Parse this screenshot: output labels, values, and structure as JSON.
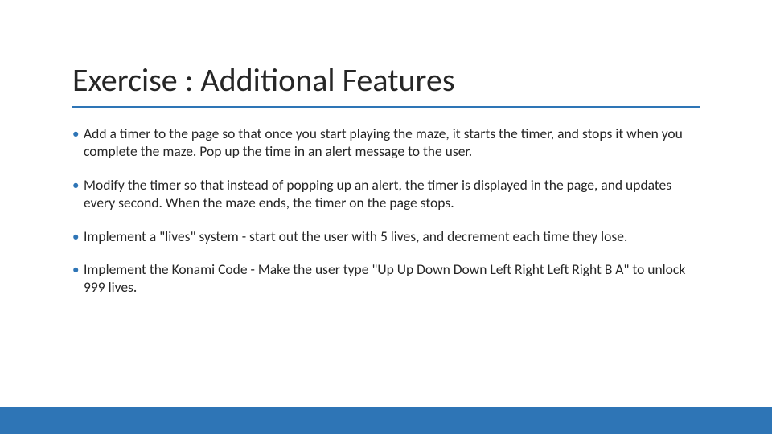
{
  "slide": {
    "title": "Exercise : Additional Features",
    "bullets": [
      "Add a timer to the page so that once you start playing the maze, it starts the timer, and stops it when you complete the maze. Pop up the time in an alert message to the user.",
      "Modify the timer so that instead of popping up an alert, the timer is displayed in the page, and updates every second. When the maze ends, the timer on the page stops.",
      "Implement a \"lives\" system - start out the user with 5 lives, and decrement each time they lose.",
      "Implement the Konami Code - Make the user type \"Up Up Down Down Left Right Left Right B A\" to unlock 999 lives."
    ]
  },
  "accent_color": "#2e75b6"
}
